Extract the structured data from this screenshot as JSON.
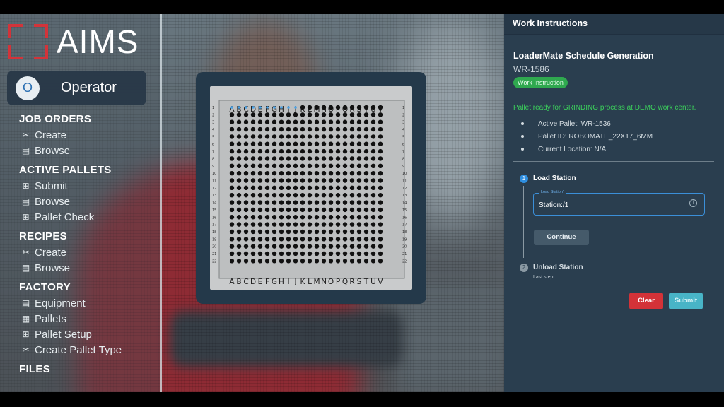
{
  "brand": {
    "name": "AIMS"
  },
  "user": {
    "initial": "O",
    "role": "Operator"
  },
  "nav": [
    {
      "section": "JOB ORDERS",
      "items": [
        {
          "label": "Create",
          "icon": "tools-icon"
        },
        {
          "label": "Browse",
          "icon": "clipboard-icon"
        }
      ]
    },
    {
      "section": "ACTIVE PALLETS",
      "items": [
        {
          "label": "Submit",
          "icon": "plus-box-icon"
        },
        {
          "label": "Browse",
          "icon": "clipboard-icon"
        },
        {
          "label": "Pallet Check",
          "icon": "plus-box-icon"
        }
      ]
    },
    {
      "section": "RECIPES",
      "items": [
        {
          "label": "Create",
          "icon": "tools-icon"
        },
        {
          "label": "Browse",
          "icon": "clipboard-icon"
        }
      ]
    },
    {
      "section": "FACTORY",
      "items": [
        {
          "label": "Equipment",
          "icon": "clipboard-icon"
        },
        {
          "label": "Pallets",
          "icon": "grid-icon"
        },
        {
          "label": "Pallet Setup",
          "icon": "plus-box-icon"
        },
        {
          "label": "Create Pallet Type",
          "icon": "tools-icon"
        }
      ]
    },
    {
      "section": "FILES",
      "items": []
    }
  ],
  "pallet": {
    "columns": [
      "A",
      "B",
      "C",
      "D",
      "E",
      "F",
      "G",
      "H",
      "I",
      "J",
      "K",
      "L",
      "M",
      "N",
      "O",
      "P",
      "Q",
      "R",
      "S",
      "T",
      "U",
      "V"
    ],
    "rows": [
      "1",
      "2",
      "3",
      "4",
      "5",
      "6",
      "7",
      "8",
      "9",
      "10",
      "11",
      "12",
      "13",
      "14",
      "15",
      "16",
      "17",
      "18",
      "19",
      "20",
      "21",
      "22"
    ],
    "highlighted_row": 1,
    "highlighted_count": 10,
    "colors": {
      "hole": "#111111",
      "highlight": "#4aa3e8"
    }
  },
  "work": {
    "header": "Work Instructions",
    "title": "LoaderMate Schedule Generation",
    "subtitle": "WR-1586",
    "badge": "Work Instruction",
    "ready_text": "Pallet ready for GRINDING process at DEMO work center.",
    "details": [
      "Active Pallet: WR-1536",
      "Pallet ID: ROBOMATE_22X17_6MM",
      "Current Location: N/A"
    ],
    "step1": {
      "number": "1",
      "label": "Load Station",
      "field_legend": "Load Station*",
      "field_value": "Station:/1",
      "continue": "Continue"
    },
    "step2": {
      "number": "2",
      "label": "Unload Station",
      "sub": "Last step"
    },
    "clear": "Clear",
    "submit": "Submit"
  }
}
